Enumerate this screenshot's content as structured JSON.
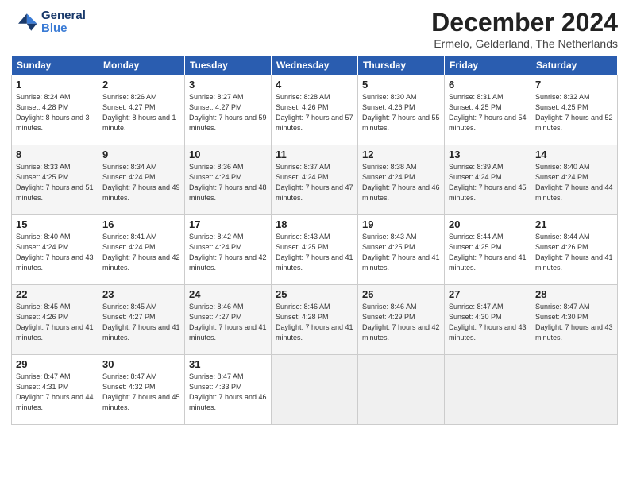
{
  "header": {
    "title": "December 2024",
    "subtitle": "Ermelo, Gelderland, The Netherlands",
    "logo_general": "General",
    "logo_blue": "Blue"
  },
  "weekdays": [
    "Sunday",
    "Monday",
    "Tuesday",
    "Wednesday",
    "Thursday",
    "Friday",
    "Saturday"
  ],
  "weeks": [
    [
      {
        "day": "1",
        "sunrise": "8:24 AM",
        "sunset": "4:28 PM",
        "daylight": "8 hours and 3 minutes"
      },
      {
        "day": "2",
        "sunrise": "8:26 AM",
        "sunset": "4:27 PM",
        "daylight": "8 hours and 1 minute"
      },
      {
        "day": "3",
        "sunrise": "8:27 AM",
        "sunset": "4:27 PM",
        "daylight": "7 hours and 59 minutes"
      },
      {
        "day": "4",
        "sunrise": "8:28 AM",
        "sunset": "4:26 PM",
        "daylight": "7 hours and 57 minutes"
      },
      {
        "day": "5",
        "sunrise": "8:30 AM",
        "sunset": "4:26 PM",
        "daylight": "7 hours and 55 minutes"
      },
      {
        "day": "6",
        "sunrise": "8:31 AM",
        "sunset": "4:25 PM",
        "daylight": "7 hours and 54 minutes"
      },
      {
        "day": "7",
        "sunrise": "8:32 AM",
        "sunset": "4:25 PM",
        "daylight": "7 hours and 52 minutes"
      }
    ],
    [
      {
        "day": "8",
        "sunrise": "8:33 AM",
        "sunset": "4:25 PM",
        "daylight": "7 hours and 51 minutes"
      },
      {
        "day": "9",
        "sunrise": "8:34 AM",
        "sunset": "4:24 PM",
        "daylight": "7 hours and 49 minutes"
      },
      {
        "day": "10",
        "sunrise": "8:36 AM",
        "sunset": "4:24 PM",
        "daylight": "7 hours and 48 minutes"
      },
      {
        "day": "11",
        "sunrise": "8:37 AM",
        "sunset": "4:24 PM",
        "daylight": "7 hours and 47 minutes"
      },
      {
        "day": "12",
        "sunrise": "8:38 AM",
        "sunset": "4:24 PM",
        "daylight": "7 hours and 46 minutes"
      },
      {
        "day": "13",
        "sunrise": "8:39 AM",
        "sunset": "4:24 PM",
        "daylight": "7 hours and 45 minutes"
      },
      {
        "day": "14",
        "sunrise": "8:40 AM",
        "sunset": "4:24 PM",
        "daylight": "7 hours and 44 minutes"
      }
    ],
    [
      {
        "day": "15",
        "sunrise": "8:40 AM",
        "sunset": "4:24 PM",
        "daylight": "7 hours and 43 minutes"
      },
      {
        "day": "16",
        "sunrise": "8:41 AM",
        "sunset": "4:24 PM",
        "daylight": "7 hours and 42 minutes"
      },
      {
        "day": "17",
        "sunrise": "8:42 AM",
        "sunset": "4:24 PM",
        "daylight": "7 hours and 42 minutes"
      },
      {
        "day": "18",
        "sunrise": "8:43 AM",
        "sunset": "4:25 PM",
        "daylight": "7 hours and 41 minutes"
      },
      {
        "day": "19",
        "sunrise": "8:43 AM",
        "sunset": "4:25 PM",
        "daylight": "7 hours and 41 minutes"
      },
      {
        "day": "20",
        "sunrise": "8:44 AM",
        "sunset": "4:25 PM",
        "daylight": "7 hours and 41 minutes"
      },
      {
        "day": "21",
        "sunrise": "8:44 AM",
        "sunset": "4:26 PM",
        "daylight": "7 hours and 41 minutes"
      }
    ],
    [
      {
        "day": "22",
        "sunrise": "8:45 AM",
        "sunset": "4:26 PM",
        "daylight": "7 hours and 41 minutes"
      },
      {
        "day": "23",
        "sunrise": "8:45 AM",
        "sunset": "4:27 PM",
        "daylight": "7 hours and 41 minutes"
      },
      {
        "day": "24",
        "sunrise": "8:46 AM",
        "sunset": "4:27 PM",
        "daylight": "7 hours and 41 minutes"
      },
      {
        "day": "25",
        "sunrise": "8:46 AM",
        "sunset": "4:28 PM",
        "daylight": "7 hours and 41 minutes"
      },
      {
        "day": "26",
        "sunrise": "8:46 AM",
        "sunset": "4:29 PM",
        "daylight": "7 hours and 42 minutes"
      },
      {
        "day": "27",
        "sunrise": "8:47 AM",
        "sunset": "4:30 PM",
        "daylight": "7 hours and 43 minutes"
      },
      {
        "day": "28",
        "sunrise": "8:47 AM",
        "sunset": "4:30 PM",
        "daylight": "7 hours and 43 minutes"
      }
    ],
    [
      {
        "day": "29",
        "sunrise": "8:47 AM",
        "sunset": "4:31 PM",
        "daylight": "7 hours and 44 minutes"
      },
      {
        "day": "30",
        "sunrise": "8:47 AM",
        "sunset": "4:32 PM",
        "daylight": "7 hours and 45 minutes"
      },
      {
        "day": "31",
        "sunrise": "8:47 AM",
        "sunset": "4:33 PM",
        "daylight": "7 hours and 46 minutes"
      },
      null,
      null,
      null,
      null
    ]
  ],
  "labels": {
    "sunrise": "Sunrise:",
    "sunset": "Sunset:",
    "daylight": "Daylight:"
  }
}
